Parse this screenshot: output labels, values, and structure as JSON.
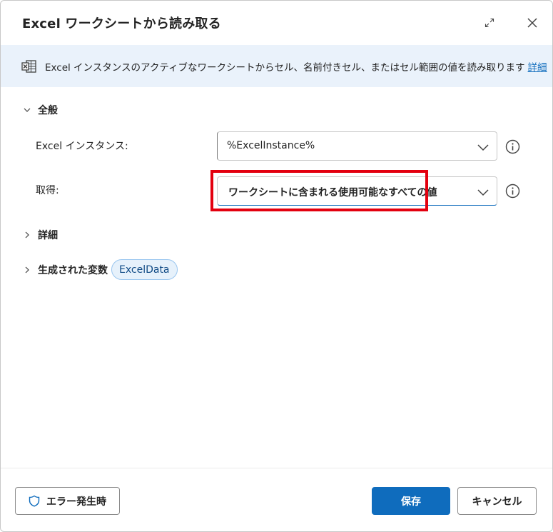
{
  "dialog": {
    "title": "Excel ワークシートから読み取る",
    "expand_icon": "expand-icon",
    "close_icon": "close-icon"
  },
  "banner": {
    "icon": "excel-icon",
    "text": "Excel インスタンスのアクティブなワークシートからセル、名前付きセル、またはセル範囲の値を読み取ります",
    "link": "詳細"
  },
  "general_section": {
    "label": "全般",
    "expanded": true
  },
  "fields": {
    "excel_instance": {
      "label": "Excel インスタンス:",
      "value": "%ExcelInstance%"
    },
    "retrieve": {
      "label": "取得:",
      "value": "ワークシートに含まれる使用可能なすべての値"
    }
  },
  "details_section": {
    "label": "詳細",
    "expanded": false
  },
  "variables_section": {
    "label": "生成された変数",
    "expanded": false,
    "variable": "ExcelData"
  },
  "footer": {
    "on_error_label": "エラー発生時",
    "save_label": "保存",
    "cancel_label": "キャンセル"
  },
  "colors": {
    "accent": "#0f6cbd",
    "banner_bg": "#eaf2fb",
    "highlight": "#e3000f"
  }
}
